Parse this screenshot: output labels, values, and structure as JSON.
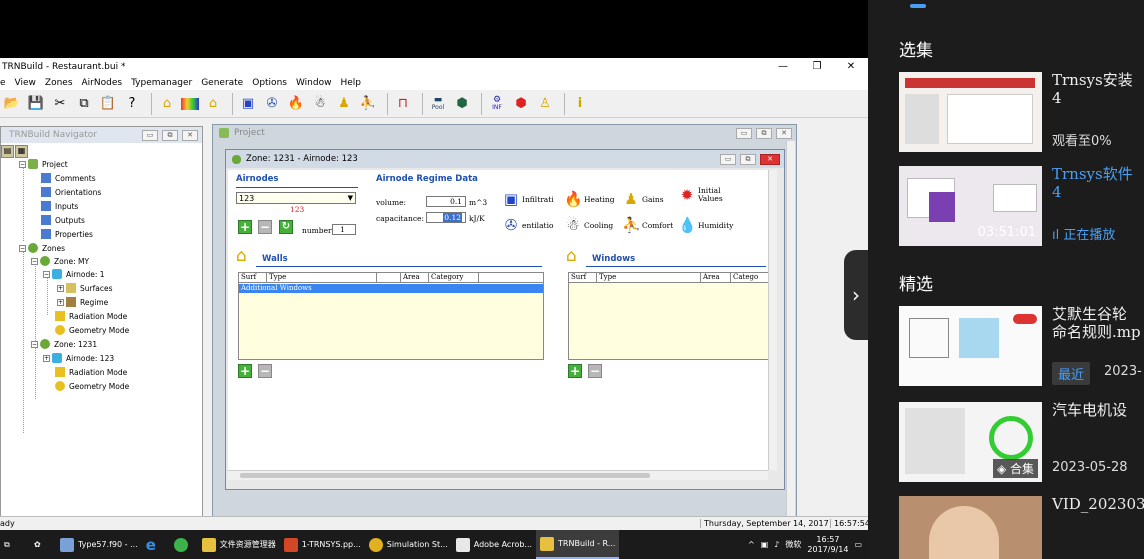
{
  "app": {
    "title": "TRNBuild - Restaurant.bui *",
    "menu": [
      "e",
      "View",
      "Zones",
      "AirNodes",
      "Typemanager",
      "Generate",
      "Options",
      "Window",
      "Help"
    ],
    "toolbar_labels": {
      "pool": "Pool",
      "inf": "INF"
    }
  },
  "navigator": {
    "title": "TRNBuild Navigator",
    "tree": {
      "project": "Project",
      "comments": "Comments",
      "orientations": "Orientations",
      "inputs": "Inputs",
      "outputs": "Outputs",
      "properties": "Properties",
      "zones": "Zones",
      "zone_my": "Zone: MY",
      "airnode_1": "Airnode: 1",
      "surfaces": "Surfaces",
      "regime": "Regime",
      "radiation_mode_1": "Radiation Mode",
      "geometry_mode_1": "Geometry Mode",
      "zone_1231": "Zone: 1231",
      "airnode_123": "Airnode: 123",
      "radiation_mode_2": "Radiation Mode",
      "geometry_mode_2": "Geometry Mode"
    }
  },
  "project_window": {
    "title": "Project"
  },
  "zone_window": {
    "title": "Zone: 1231   -   Airnode: 123",
    "airnodes_header": "Airnodes",
    "airnode_value": "123",
    "airnode_red": "123",
    "number_label": "number:",
    "number_value": "1",
    "regime_header": "Airnode Regime Data",
    "volume_label": "volume:",
    "volume_value": "0.1",
    "volume_unit": "m^3",
    "capacitance_label": "capacitance:",
    "capacitance_value": "0.12",
    "capacitance_unit": "kJ/K",
    "icons": {
      "infiltration": "Infiltrati",
      "heating": "Heating",
      "gains": "Gains",
      "initial": "Initial\nValues",
      "ventilation": "entilatio",
      "cooling": "Cooling",
      "comfort": "Comfort",
      "humidity": "Humidity"
    },
    "walls_header": "Walls",
    "walls_columns": [
      "Surf",
      "Type",
      "",
      "Area",
      "Category"
    ],
    "walls_rows": [
      "Additional Windows"
    ],
    "windows_header": "Windows",
    "windows_columns": [
      "Surf",
      "Type",
      "Area",
      "Catego"
    ]
  },
  "status": {
    "left": "ady",
    "date": "Thursday, September 14, 2017",
    "time": "16:57:54"
  },
  "taskbar": {
    "items": [
      "Type57.f90 - ...",
      "文件资源管理器",
      "1-TRNSYS.pp...",
      "Simulation St...",
      "Adobe Acrob...",
      "TRNBuild - R..."
    ],
    "ime": "微软",
    "clock_time": "16:57",
    "clock_date": "2017/9/14"
  },
  "sidebar": {
    "section1": "选集",
    "section2": "精选",
    "cards": [
      {
        "title": "Trnsys安装",
        "sub": "4",
        "meta": "观看至0%"
      },
      {
        "title": "Trnsys软件",
        "sub": "4",
        "duration": "03:51:01",
        "meta": "正在播放"
      },
      {
        "title": "艾默生谷轮",
        "sub": "命名规则.mp",
        "badge": "最近",
        "meta": "2023-"
      },
      {
        "title": "汽车电机设",
        "badge": "合集",
        "meta": "2023-05-28"
      },
      {
        "title": "VID_202303"
      }
    ]
  },
  "colors": {
    "accent": "#4a9ff5",
    "header_blue": "#2050b0",
    "select_blue": "#3a86f0"
  }
}
